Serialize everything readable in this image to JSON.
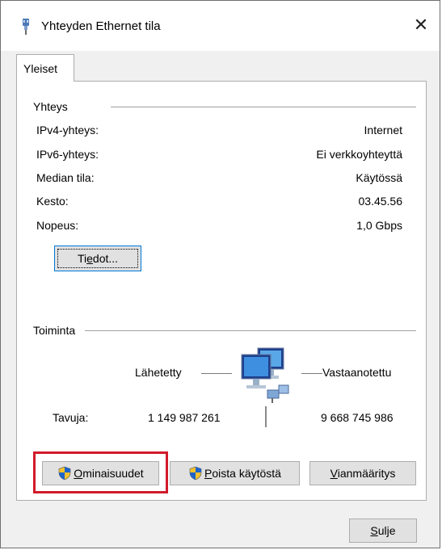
{
  "window": {
    "title": "Yhteyden Ethernet tila",
    "close_glyph": "✕"
  },
  "tabs": [
    {
      "label": "Yleiset",
      "active": true
    }
  ],
  "connection": {
    "group_label": "Yhteys",
    "rows": [
      {
        "label": "IPv4-yhteys:",
        "value": "Internet"
      },
      {
        "label": "IPv6-yhteys:",
        "value": "Ei verkkoyhteyttä"
      },
      {
        "label": "Median tila:",
        "value": "Käytössä"
      },
      {
        "label": "Kesto:",
        "value": "03.45.56"
      },
      {
        "label": "Nopeus:",
        "value": "1,0 Gbps"
      }
    ],
    "details_button": {
      "pre": "Ti",
      "accel": "e",
      "post": "dot..."
    }
  },
  "activity": {
    "group_label": "Toiminta",
    "sent_label": "Lähetetty",
    "received_label": "Vastaanotettu",
    "bytes_label": "Tavuja:",
    "bytes_sent": "1 149 987 261",
    "bytes_received": "9 668 745 986",
    "icon": "network-computers-icon"
  },
  "actions": {
    "properties": {
      "accel": "O",
      "rest": "minaisuudet",
      "icon": "uac-shield-icon"
    },
    "disable": {
      "accel": "P",
      "rest": "oista käytöstä",
      "icon": "uac-shield-icon"
    },
    "diagnose": {
      "accel": "V",
      "rest": "ianmääritys"
    }
  },
  "footer": {
    "close": {
      "accel": "S",
      "rest": "ulje"
    }
  },
  "colors": {
    "highlight": "#d11a2a",
    "accent": "#0078d7"
  }
}
